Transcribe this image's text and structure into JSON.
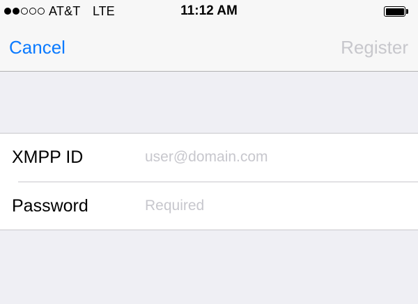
{
  "status_bar": {
    "signal_filled": 2,
    "signal_total": 5,
    "carrier": "AT&T",
    "network": "LTE",
    "time": "11:12 AM",
    "battery_level": 1.0
  },
  "nav_bar": {
    "cancel_label": "Cancel",
    "register_label": "Register",
    "cancel_color": "#0a7aff",
    "register_disabled_color": "#c7c7cc"
  },
  "form": {
    "xmpp_id": {
      "label": "XMPP ID",
      "value": "",
      "placeholder": "user@domain.com"
    },
    "password": {
      "label": "Password",
      "value": "",
      "placeholder": "Required"
    }
  }
}
